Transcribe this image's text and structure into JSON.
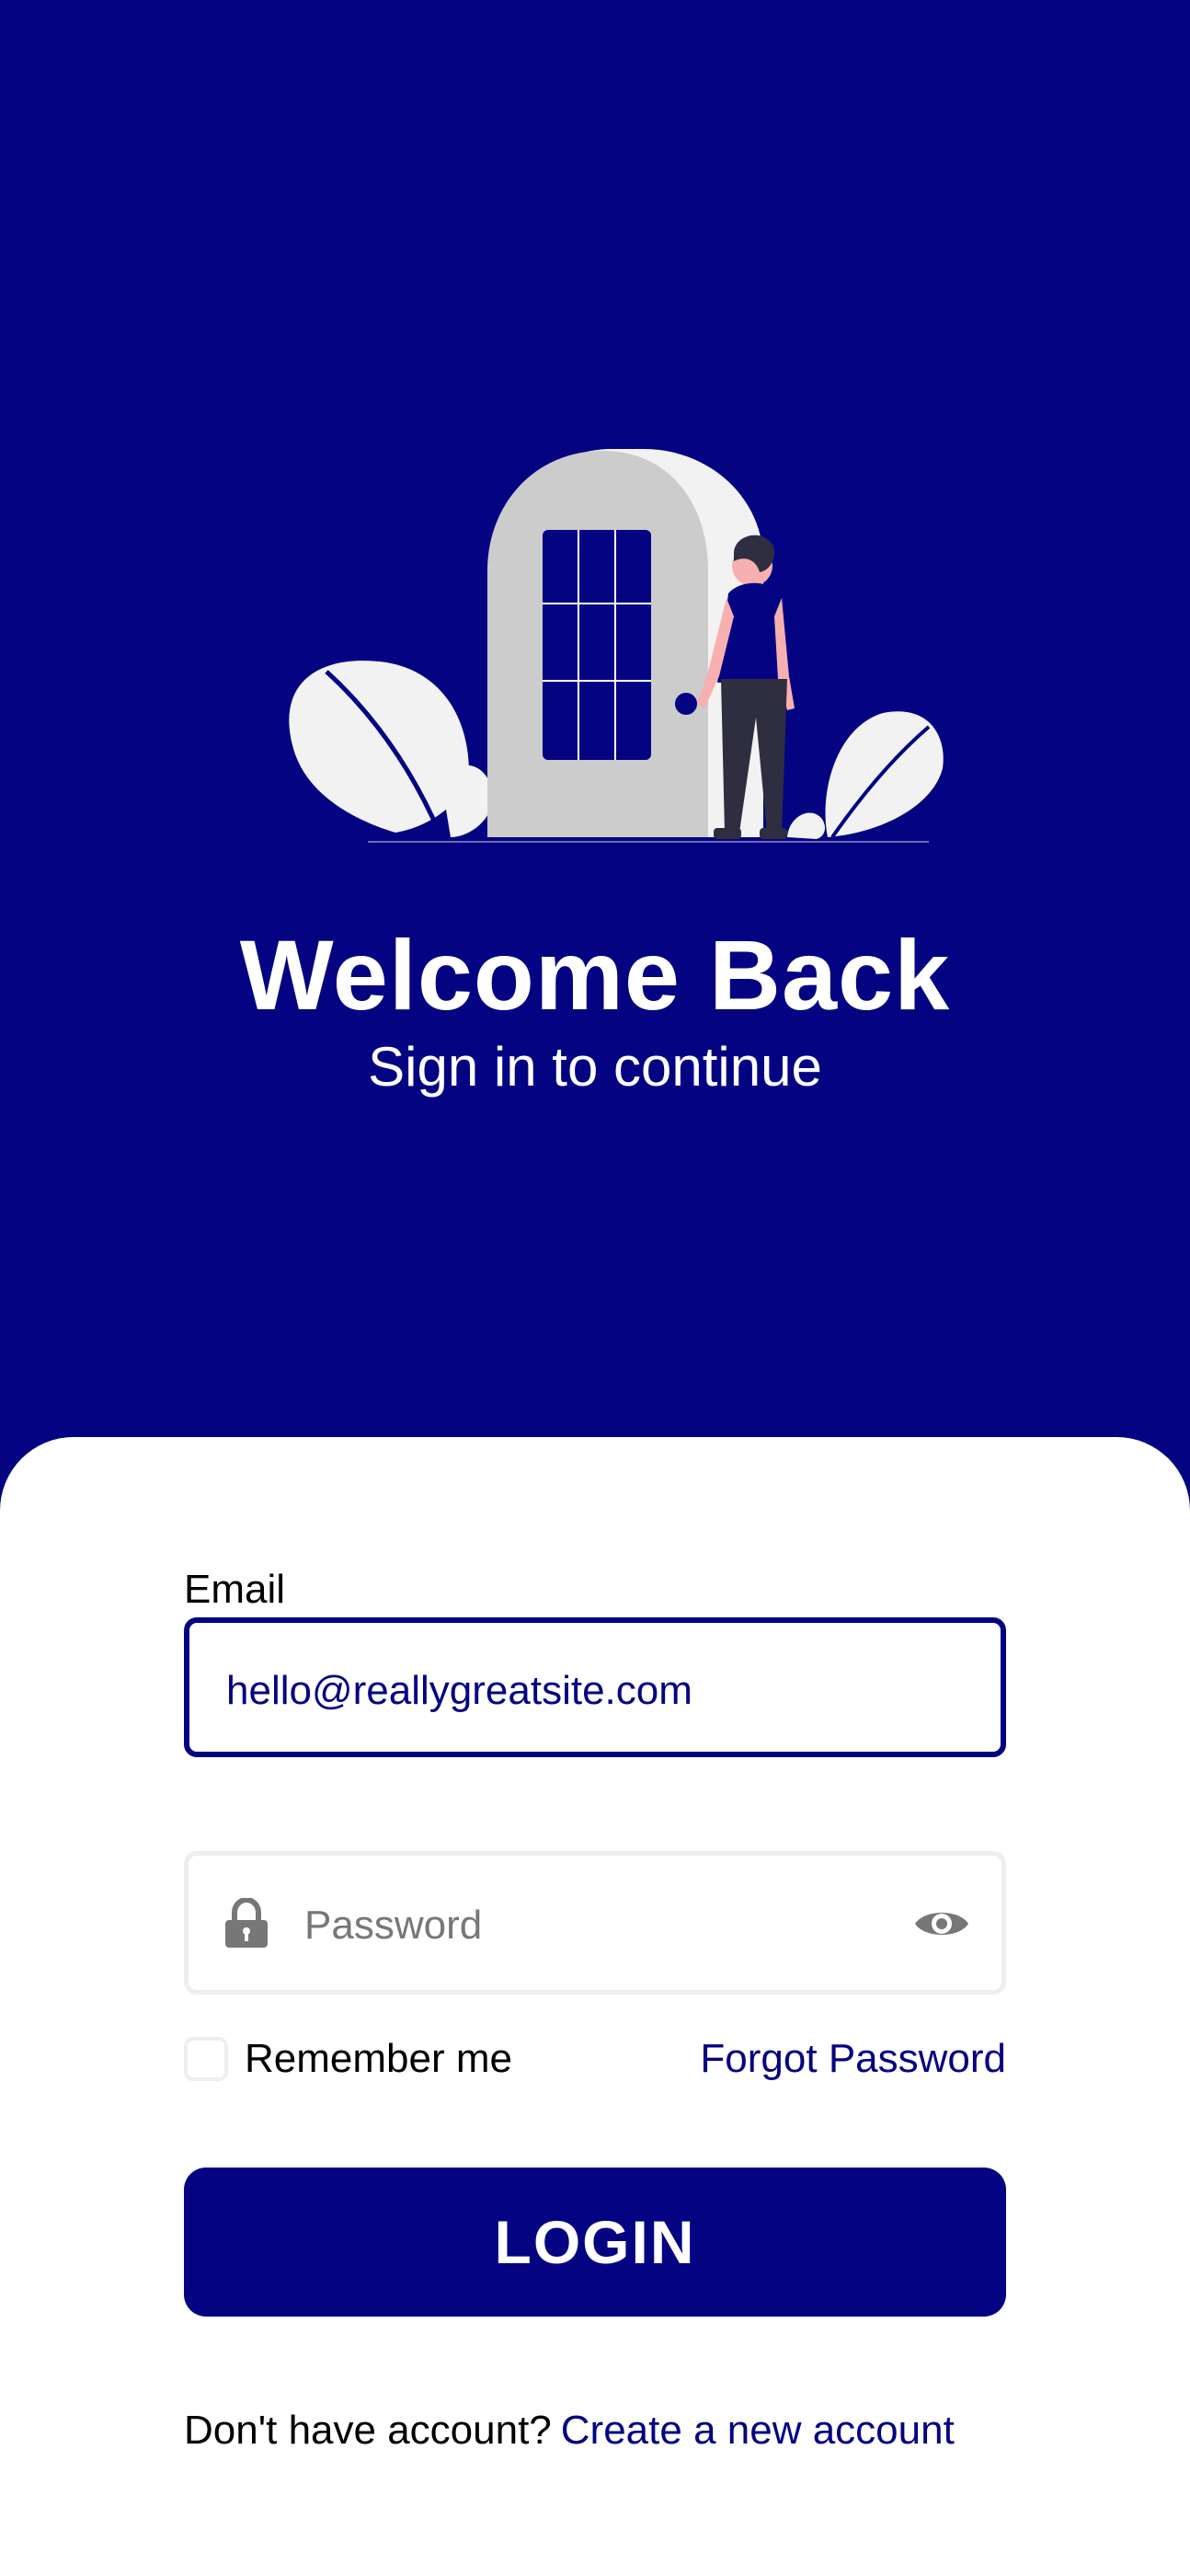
{
  "colors": {
    "brand": "#040482",
    "background_card": "#ffffff",
    "text": "#000000",
    "muted": "#777777",
    "input_border": "#eeeeee"
  },
  "hero": {
    "title": "Welcome Back",
    "subtitle": "Sign in to continue",
    "illustration": "person-opening-door-illustration"
  },
  "form": {
    "email_label": "Email",
    "email_value": "hello@reallygreatsite.com",
    "password_placeholder": "Password",
    "password_icon": "lock-icon",
    "password_toggle_icon": "eye-icon",
    "remember_label": "Remember me",
    "remember_checked": false,
    "forgot_label": "Forgot Password",
    "login_label": "LOGIN"
  },
  "footer": {
    "prompt": "Don't have account?",
    "link": "Create a new account"
  }
}
